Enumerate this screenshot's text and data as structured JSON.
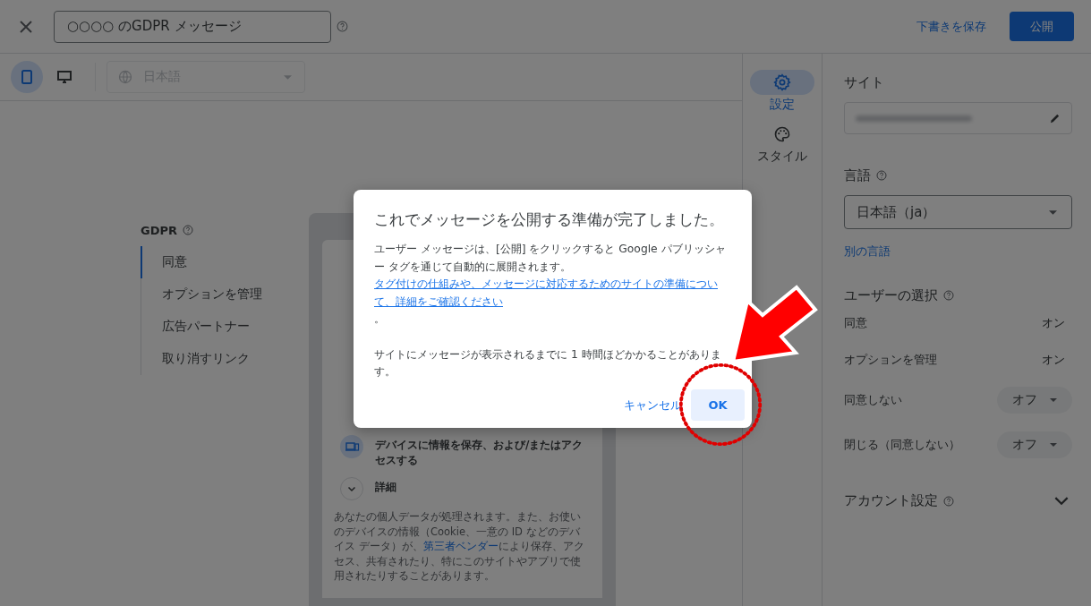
{
  "header": {
    "title_value": "○○○○ のGDPR メッセージ",
    "save_draft": "下書きを保存",
    "publish": "公開"
  },
  "toolbar": {
    "devices": [
      {
        "kind": "mobile",
        "selected": true
      },
      {
        "kind": "desktop",
        "selected": false
      }
    ],
    "language": "日本語"
  },
  "nav": {
    "heading": "GDPR",
    "items": [
      {
        "label": "同意",
        "selected": true
      },
      {
        "label": "オプションを管理",
        "selected": false
      },
      {
        "label": "広告パートナー",
        "selected": false
      },
      {
        "label": "取り消すリンク",
        "selected": false
      }
    ]
  },
  "preview": {
    "purpose": "デバイスに情報を保存、および/またはアクセスする",
    "details": "詳細",
    "paragraph_before": "あなたの個人データが処理されます。また、お使いのデバイスの情報（Cookie、一意の ID などのデバイス データ）が、",
    "paragraph_link": "第三者ベンダー",
    "paragraph_after": "により保存、アクセス、共有されたり、特にこのサイトやアプリで使用されたりすることがあります。"
  },
  "side_tabs": [
    {
      "kind": "settings",
      "label": "設定",
      "selected": true
    },
    {
      "kind": "style",
      "label": "スタイル",
      "selected": false
    }
  ],
  "settings": {
    "site_label": "サイト",
    "language_label": "言語",
    "language_value": "日本語（ja）",
    "other_language": "別の言語",
    "choices_heading": "ユーザーの選択",
    "choices": [
      {
        "kind": "text",
        "label": "同意",
        "value": "オン"
      },
      {
        "kind": "text",
        "label": "オプションを管理",
        "value": "オン"
      },
      {
        "kind": "dropdown",
        "label": "同意しない",
        "value": "オフ"
      },
      {
        "kind": "dropdown",
        "label": "閉じる（同意しない）",
        "value": "オフ"
      }
    ],
    "account_settings": "アカウント設定",
    "account_expanded": false
  },
  "dialog": {
    "title": "これでメッセージを公開する準備が完了しました。",
    "body_before": "ユーザー メッセージは、[公開] をクリックすると Google パブリッシャー タグを通じて自動的に展開されます。",
    "body_link": "タグ付けの仕組みや、メッセージに対応するためのサイトの準備について、詳細をご確認ください",
    "body_after": "。",
    "note": "サイトにメッセージが表示されるまでに 1 時間ほどかかることがあります。",
    "cancel": "キャンセル",
    "ok": "OK"
  }
}
